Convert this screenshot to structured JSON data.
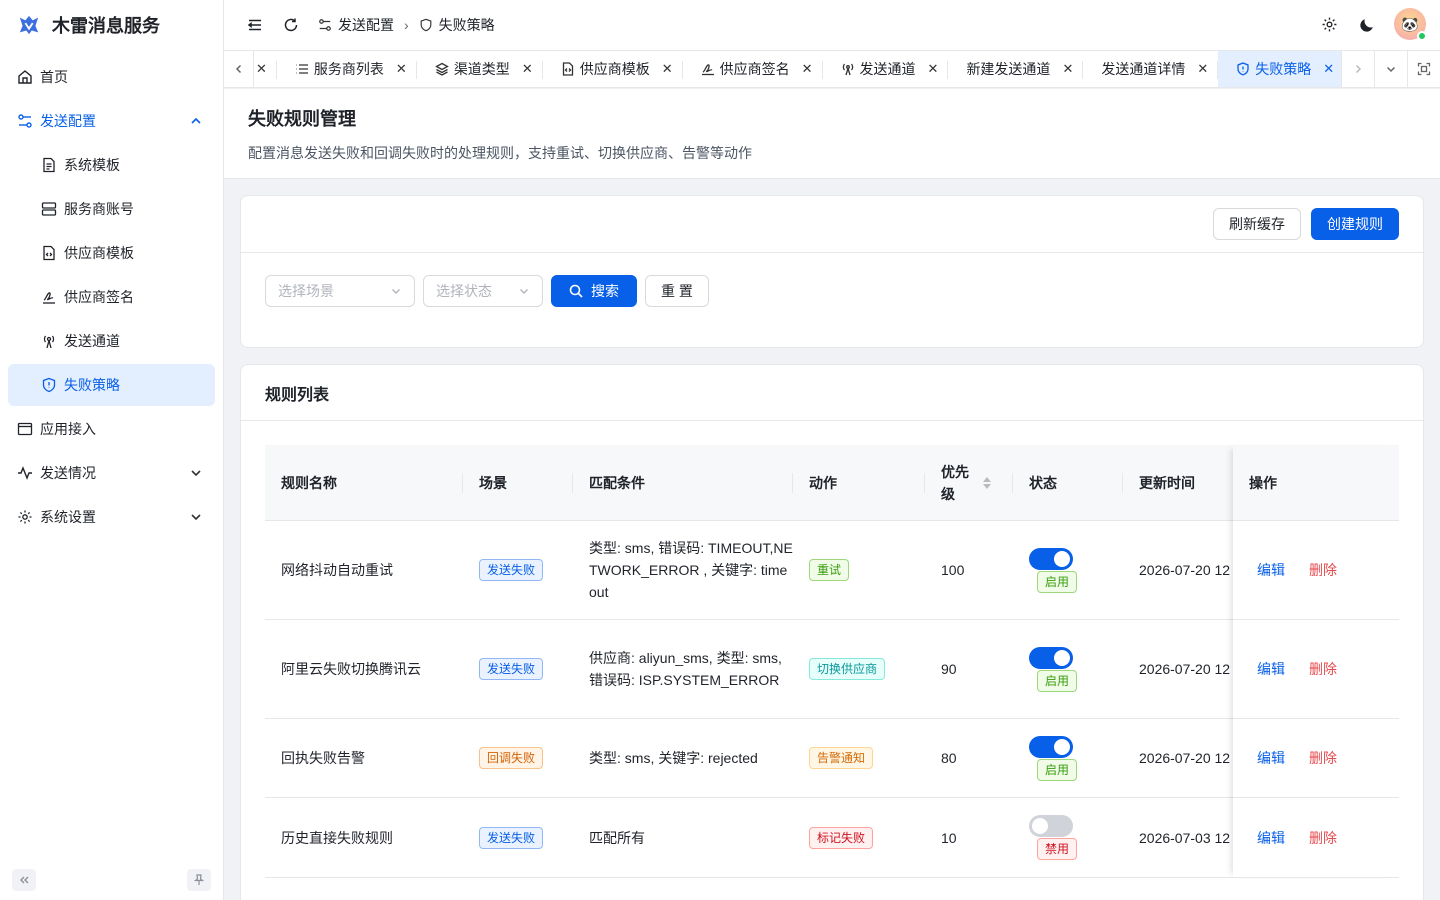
{
  "app": {
    "title": "木雷消息服务"
  },
  "sidebar": {
    "items": [
      {
        "label": "首页"
      },
      {
        "label": "发送配置"
      },
      {
        "label": "系统模板"
      },
      {
        "label": "服务商账号"
      },
      {
        "label": "供应商模板"
      },
      {
        "label": "供应商签名"
      },
      {
        "label": "发送通道"
      },
      {
        "label": "失败策略"
      },
      {
        "label": "应用接入"
      },
      {
        "label": "发送情况"
      },
      {
        "label": "系统设置"
      }
    ]
  },
  "breadcrumb": {
    "parent": "发送配置",
    "current": "失败策略"
  },
  "tabs": [
    {
      "label": "服务商列表"
    },
    {
      "label": "渠道类型"
    },
    {
      "label": "供应商模板"
    },
    {
      "label": "供应商签名"
    },
    {
      "label": "发送通道"
    },
    {
      "label": "新建发送通道"
    },
    {
      "label": "发送通道详情"
    },
    {
      "label": "失败策略"
    }
  ],
  "page": {
    "title": "失败规则管理",
    "description": "配置消息发送失败和回调失败时的处理规则，支持重试、切换供应商、告警等动作"
  },
  "toolbar": {
    "refresh_label": "刷新缓存",
    "create_label": "创建规则"
  },
  "filters": {
    "scene_placeholder": "选择场景",
    "status_placeholder": "选择状态",
    "search_label": "搜索",
    "reset_label": "重 置"
  },
  "table": {
    "title": "规则列表",
    "columns": [
      "规则名称",
      "场景",
      "匹配条件",
      "动作",
      "优先级",
      "状态",
      "更新时间",
      "操作"
    ],
    "rows": [
      {
        "name": "网络抖动自动重试",
        "scene": "发送失败",
        "condition": "类型: sms, 错误码: TIMEOUT,NETWORK_ERROR , 关键字: timeout",
        "action": "重试",
        "priority": "100",
        "status": "启用",
        "updated": "2026-07-20 12",
        "edit": "编辑",
        "delete": "删除"
      },
      {
        "name": "阿里云失败切换腾讯云",
        "scene": "发送失败",
        "condition": "供应商: aliyun_sms, 类型: sms, 错误码: ISP.SYSTEM_ERROR",
        "action": "切换供应商",
        "priority": "90",
        "status": "启用",
        "updated": "2026-07-20 12",
        "edit": "编辑",
        "delete": "删除"
      },
      {
        "name": "回执失败告警",
        "scene": "回调失败",
        "condition": "类型: sms, 关键字: rejected",
        "action": "告警通知",
        "priority": "80",
        "status": "启用",
        "updated": "2026-07-20 12",
        "edit": "编辑",
        "delete": "删除"
      },
      {
        "name": "历史直接失败规则",
        "scene": "发送失败",
        "condition": "匹配所有",
        "action": "标记失败",
        "priority": "10",
        "status": "禁用",
        "updated": "2026-07-03 12",
        "edit": "编辑",
        "delete": "删除"
      }
    ]
  },
  "colors": {
    "primary": "#0960e8",
    "danger": "#e5484d"
  }
}
